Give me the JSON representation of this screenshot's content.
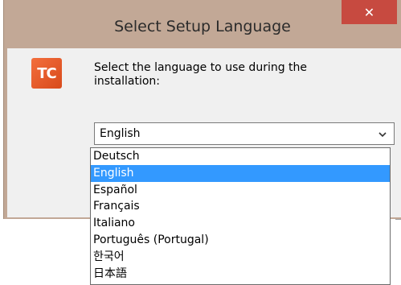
{
  "window": {
    "title": "Select Setup Language",
    "close_label": "✕"
  },
  "logo": {
    "text": "TC"
  },
  "prompt": {
    "text": "Select the language to use during the installation:"
  },
  "select": {
    "value": "English"
  },
  "dropdown": {
    "options": [
      {
        "label": "Deutsch",
        "selected": false
      },
      {
        "label": "English",
        "selected": true
      },
      {
        "label": "Español",
        "selected": false
      },
      {
        "label": "Français",
        "selected": false
      },
      {
        "label": "Italiano",
        "selected": false
      },
      {
        "label": "Português (Portugal)",
        "selected": false
      },
      {
        "label": "한국어",
        "selected": false
      },
      {
        "label": "日本語",
        "selected": false
      }
    ]
  }
}
